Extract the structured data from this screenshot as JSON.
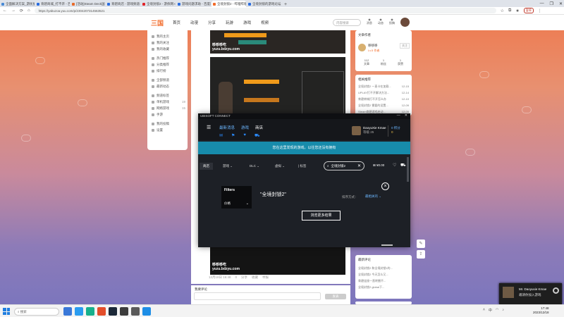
{
  "browser": {
    "tabs": [
      {
        "title": "全面解决方案_游民星空",
        "color": "#4a8bd6",
        "active": false
      },
      {
        "title": "育碧商城_打不开 - 百度",
        "color": "#2a6de0",
        "active": false
      },
      {
        "title": "[活动]Steam Deck国区",
        "color": "#e86b2b",
        "active": false
      },
      {
        "title": "育碧商店 - 游戏频道",
        "color": "#2a6de0",
        "active": false
      },
      {
        "title": "全境封锁2 - 游侠网",
        "color": "#e0262b",
        "active": false
      },
      {
        "title": "游戏问题求助 - 百度贴吧",
        "color": "#2a6de0",
        "active": false
      },
      {
        "title": "全境封锁2 - 哔哩哔哩",
        "color": "#f26c2b",
        "active": true
      },
      {
        "title": "全境封锁的游戏论坛",
        "color": "#2a6de0",
        "active": false
      }
    ],
    "new_tab": "+",
    "url": "https://yabuzoa.yuu.com/p/2304207314563521",
    "paused_label": "暂停",
    "window_controls": [
      "—",
      "❐",
      "✕"
    ]
  },
  "site": {
    "logo": "三国",
    "nav": [
      "首页",
      "动漫",
      "分享",
      "玩游",
      "游戏",
      "视频"
    ],
    "search_placeholder": "内容搜索",
    "header_icons": [
      {
        "icon": "message-icon",
        "label": "消息"
      },
      {
        "icon": "bell-icon",
        "label": "动态"
      },
      {
        "icon": "upload-icon",
        "label": "投稿"
      }
    ]
  },
  "left_sidebar": {
    "groups": [
      [
        {
          "label": "我的主页"
        },
        {
          "label": "我的关注"
        },
        {
          "label": "我的收藏"
        }
      ],
      [
        {
          "label": "热门推荐"
        },
        {
          "label": "分类推荐"
        },
        {
          "label": "排行榜"
        }
      ],
      [
        {
          "label": "全部频道"
        },
        {
          "label": "最新动态"
        }
      ],
      [
        {
          "label": "频道标签",
          "count": ""
        },
        {
          "label": "单机游戏",
          "count": "19"
        },
        {
          "label": "网络游戏",
          "count": "15"
        },
        {
          "label": "手游",
          "count": ""
        }
      ],
      [
        {
          "label": "我的投稿"
        },
        {
          "label": "设置"
        }
      ]
    ]
  },
  "content": {
    "shot1_caption": "哆哆哆吃\nyuzu.bdzyu.com",
    "shot3_caption": "哆哆哆吃\nyuzu.bdzyu.com",
    "post_actions": [
      "12月18日 16:48",
      "0",
      "分享",
      "收藏",
      "举报"
    ],
    "comment_label": "我要评论",
    "comment_button": "发表"
  },
  "right_sidebar": {
    "author_title": "文章作者",
    "author_name": "哆哆哆",
    "author_badge": "Lv.5 作者",
    "follow": "关注",
    "stats": [
      {
        "value": "112",
        "label": "文章"
      },
      {
        "value": "1",
        "label": "粉丝"
      },
      {
        "value": "1",
        "label": "获赞"
      }
    ],
    "related_title": "相关推荐",
    "related": [
      {
        "text": "全境封锁2 一直卡在加载...",
        "date": "12-15"
      },
      {
        "text": "UPLAY打不开解决方法...",
        "date": "12-14"
      },
      {
        "text": "育碧商城打不开怎么办",
        "date": "12-10"
      },
      {
        "text": "全境封锁2 需要的设置...",
        "date": "12-09"
      },
      {
        "text": "Steam育碧游戏启动...",
        "date": "12-05"
      }
    ],
    "latest_title": "最新评论",
    "latest": [
      "全境封锁2 和全境封锁1的...",
      "全境封锁2 今天怎么又...",
      "育碧连接一直转圈不...",
      "全境封锁2 global下..."
    ]
  },
  "ubisoft": {
    "title": "UBISOFT CONNECT",
    "menu": [
      {
        "label": "最新消息",
        "highlight": true
      },
      {
        "label": "游戏",
        "highlight": true
      },
      {
        "label": "商店",
        "highlight": false
      }
    ],
    "username": "DaoyuXie Kmae",
    "user_sub": "等级 25",
    "points_label": "0 积分",
    "points_value": "0",
    "banner": "您在这里发现的游戏，以往您还没有拥有",
    "shop_label": "商店",
    "dropdowns": [
      "游戏",
      "DLC",
      "虚拟",
      "标签"
    ],
    "search_value": "全境封锁2",
    "price": "¥0.00",
    "filters_title": "Filters",
    "filters_price": "价格",
    "no_result_text": "\"全境封锁2\"",
    "sort_text": "排序方式：",
    "sort_value": "最相关的",
    "more_results": "浏览更多结果"
  },
  "notification": {
    "name": "Mr. Daoyuxie Kmae",
    "message": "邀请你加入游戏"
  },
  "taskbar": {
    "search_placeholder": "搜索",
    "apps": [
      "#3a78d8",
      "#2a9cf0",
      "#18b08c",
      "#e34e2b",
      "#1b2838",
      "#3c3c3c",
      "#5a5a5a",
      "#1e8ee6"
    ],
    "time": "17:48",
    "date": "2023/12/18",
    "lang": "中"
  }
}
